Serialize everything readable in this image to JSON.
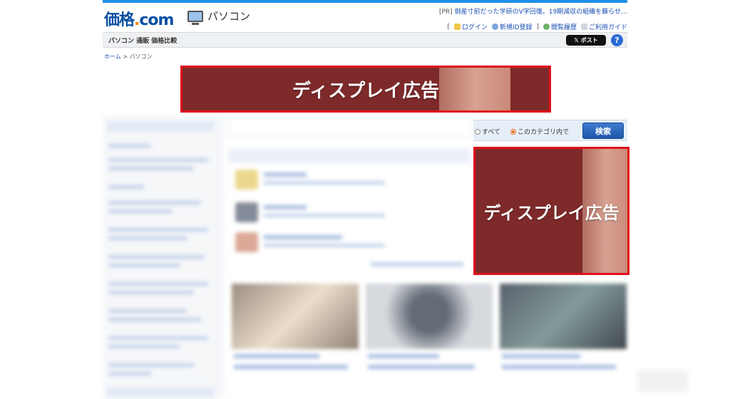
{
  "header": {
    "logo_main": "価格",
    "logo_dot": ".",
    "logo_com": "com",
    "category": "パソコン",
    "pr_tag": "[PR]",
    "pr_text": "倒産寸前だった学研のV字回復。19期減収の組織を蘇らせ…",
    "links": {
      "login": "ログイン",
      "register": "新規ID登録",
      "history": "閲覧履歴",
      "guide": "ご利用ガイド"
    }
  },
  "subbar": {
    "label": "パソコン 通販 価格比較",
    "post_label": "ポスト",
    "post_icon": "x-logo-icon",
    "help_label": "?"
  },
  "breadcrumb": {
    "home": "ホーム",
    "separator": ">",
    "current": "パソコン"
  },
  "ads": {
    "banner_label": "ディスプレイ広告",
    "side_label": "ディスプレイ広告",
    "border_color": "#e0101a",
    "fill_color": "#7f2a2a"
  },
  "search_scope": {
    "option_all": "すべて",
    "option_category": "このカテゴリ内で",
    "selected": "このカテゴリ内で",
    "button_label": "検索"
  },
  "colors": {
    "accent": "#1e90e8",
    "brand": "#0b4fa3",
    "link": "#1a4fb3",
    "radio_selected": "#e06a1a"
  }
}
